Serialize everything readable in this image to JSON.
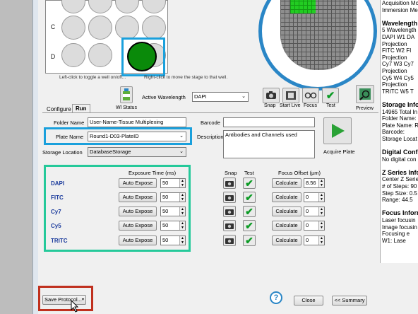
{
  "plate": {
    "row_labels": [
      "C",
      "D"
    ],
    "hint_left": "Left-click to toggle a well on/off...",
    "hint_right": "Right-click to move the stage to that well."
  },
  "toolbar": {
    "active_wavelength_label": "Active Wavelength",
    "active_wavelength_value": "DAPI",
    "wl_status_label": "Wl Status",
    "snap_label": "Snap",
    "start_live_label": "Start Live",
    "focus_label": "Focus",
    "test_label": "Test",
    "preview_label": "Preview"
  },
  "tabs": [
    {
      "label": "Configure"
    },
    {
      "label": "Run"
    }
  ],
  "form": {
    "folder_name_label": "Folder Name",
    "folder_name_value": "User-Name-Tissue Multiplexing",
    "plate_name_label": "Plate Name",
    "plate_name_value": "Round1-D03-PlateID",
    "storage_location_label": "Storage Location",
    "storage_location_value": "DatabaseStorage",
    "barcode_label": "Barcode",
    "barcode_value": "",
    "description_label": "Description",
    "description_value": "Antibodies and Channels used",
    "acquire_plate_label": "Acquire Plate"
  },
  "channels_header": {
    "exposure_time": "Exposure Time (ms)",
    "snap": "Snap",
    "test": "Test",
    "focus_offset": "Focus Offset (µm)"
  },
  "channels": [
    {
      "name": "DAPI",
      "auto_expose": "Auto Expose",
      "exposure": "50",
      "calculate": "Calculate",
      "offset": "8.56"
    },
    {
      "name": "FITC",
      "auto_expose": "Auto Expose",
      "exposure": "50",
      "calculate": "Calculate",
      "offset": "0"
    },
    {
      "name": "Cy7",
      "auto_expose": "Auto Expose",
      "exposure": "50",
      "calculate": "Calculate",
      "offset": "0"
    },
    {
      "name": "Cy5",
      "auto_expose": "Auto Expose",
      "exposure": "50",
      "calculate": "Calculate",
      "offset": "0"
    },
    {
      "name": "TRITC",
      "auto_expose": "Auto Expose",
      "exposure": "50",
      "calculate": "Calculate",
      "offset": "0"
    }
  ],
  "bottom": {
    "save_protocol": "Save Protocol...",
    "close": "Close",
    "summary": "<< Summary",
    "help_icon_text": "?"
  },
  "info_panel": {
    "lines": [
      {
        "text": "Acquisition Mo",
        "bold": false
      },
      {
        "text": "Immersion Me",
        "bold": false
      },
      {
        "text": "",
        "bold": false
      },
      {
        "text": "Wavelength",
        "bold": true
      },
      {
        "text": "5 Wavelength",
        "bold": false
      },
      {
        "text": "DAPI   W1 DA",
        "bold": false
      },
      {
        "text": "Projection",
        "bold": false
      },
      {
        "text": "FITC    W2 FI",
        "bold": false
      },
      {
        "text": "Projection",
        "bold": false
      },
      {
        "text": "Cy7    W3 Cy7",
        "bold": false
      },
      {
        "text": "Projection",
        "bold": false
      },
      {
        "text": "Cy5    W4 Cy5",
        "bold": false
      },
      {
        "text": "Projection",
        "bold": false
      },
      {
        "text": "TRITC   W5 T",
        "bold": false
      },
      {
        "text": "",
        "bold": false
      },
      {
        "text": "Storage Info",
        "bold": true
      },
      {
        "text": "14965 Total In",
        "bold": false
      },
      {
        "text": "Folder Name:",
        "bold": false
      },
      {
        "text": "Plate Name: R",
        "bold": false
      },
      {
        "text": "Barcode:",
        "bold": false
      },
      {
        "text": "Storage Locat",
        "bold": false
      },
      {
        "text": "",
        "bold": false
      },
      {
        "text": "Digital Conf",
        "bold": true
      },
      {
        "text": "No digital con",
        "bold": false
      },
      {
        "text": "",
        "bold": false
      },
      {
        "text": "Z Series Info",
        "bold": true
      },
      {
        "text": "Center Z Serie",
        "bold": false
      },
      {
        "text": "# of Steps: 90",
        "bold": false
      },
      {
        "text": "Step Size: 0.5",
        "bold": false
      },
      {
        "text": "Range: 44.5",
        "bold": false
      },
      {
        "text": "",
        "bold": false
      },
      {
        "text": "Focus Inform",
        "bold": true
      },
      {
        "text": "Laser focusin",
        "bold": false
      },
      {
        "text": "Image focusin",
        "bold": false
      },
      {
        "text": "   Focusing e",
        "bold": false
      },
      {
        "text": "      W1: Lase",
        "bold": false
      }
    ]
  },
  "colors": {
    "highlight_blue": "#1aa0dc",
    "highlight_teal": "#25c99a",
    "highlight_red": "#c0301e",
    "selected_well": "#0a8a0a",
    "channel_name": "#1a3a9c"
  }
}
